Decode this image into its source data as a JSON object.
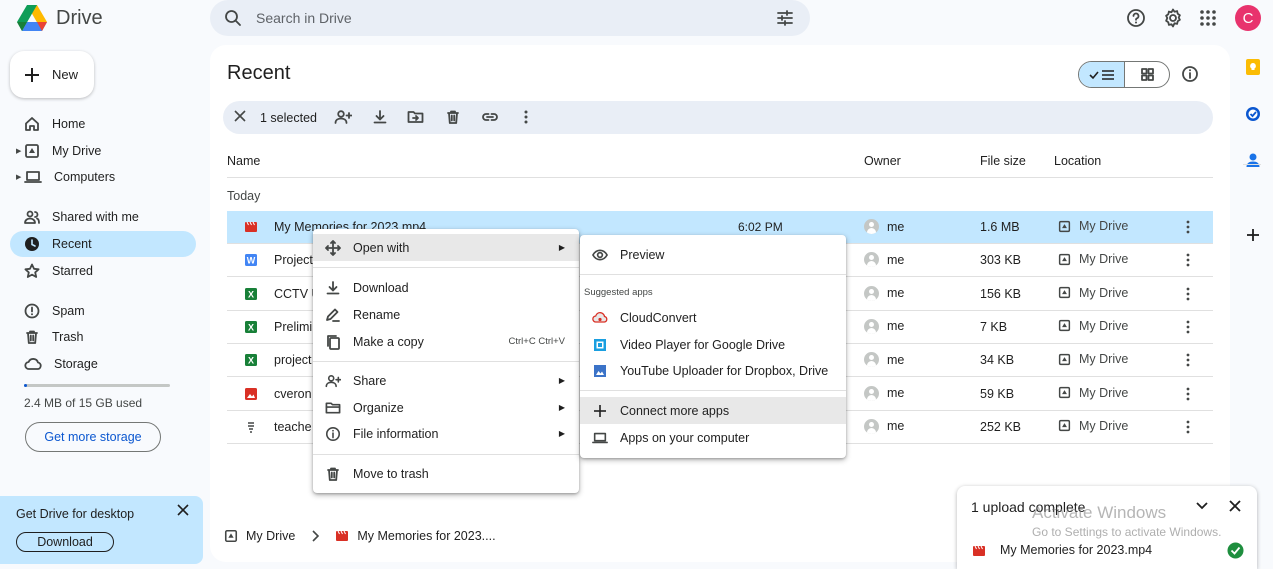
{
  "header": {
    "app_name": "Drive",
    "search_placeholder": "Search in Drive",
    "avatar_letter": "C",
    "icons": [
      "drive-logo-icon",
      "search-icon",
      "search-options-icon",
      "help-icon",
      "settings-icon",
      "apps-grid-icon"
    ]
  },
  "sidebar": {
    "new_label": "New",
    "items": [
      {
        "label": "Home",
        "icon": "home-icon"
      },
      {
        "label": "My Drive",
        "icon": "my-drive-icon"
      },
      {
        "label": "Computers",
        "icon": "computer-icon"
      },
      {
        "label": "Shared with me",
        "icon": "shared-icon"
      },
      {
        "label": "Recent",
        "icon": "clock-icon"
      },
      {
        "label": "Starred",
        "icon": "star-icon"
      },
      {
        "label": "Spam",
        "icon": "spam-icon"
      },
      {
        "label": "Trash",
        "icon": "trash-icon"
      },
      {
        "label": "Storage",
        "icon": "cloud-icon"
      }
    ],
    "storage_used_fraction": 0.0002,
    "storage_text": "2.4 MB of 15 GB used",
    "get_storage_label": "Get more storage",
    "desktop_promo_title": "Get Drive for desktop",
    "desktop_promo_button": "Download"
  },
  "main": {
    "title": "Recent",
    "selection_text": "1 selected",
    "columns": {
      "name": "Name",
      "owner": "Owner",
      "size": "File size",
      "location": "Location"
    },
    "section": "Today",
    "files": [
      {
        "name": "My Memories for 2023.mp4",
        "type": "video",
        "time": "6:02 PM",
        "owner": "me",
        "size": "1.6 MB",
        "location": "My Drive",
        "selected": true
      },
      {
        "name": "Project",
        "type": "doc",
        "owner": "me",
        "size": "303 KB",
        "location": "My Drive"
      },
      {
        "name": "CCTV U",
        "type": "sheet",
        "owner": "me",
        "size": "156 KB",
        "location": "My Drive"
      },
      {
        "name": "Prelimi",
        "type": "sheet",
        "owner": "me",
        "size": "7 KB",
        "location": "My Drive"
      },
      {
        "name": "project",
        "type": "sheet",
        "owner": "me",
        "size": "34 KB",
        "location": "My Drive"
      },
      {
        "name": "cveron",
        "type": "image",
        "owner": "me",
        "size": "59 KB",
        "location": "My Drive"
      },
      {
        "name": "teache",
        "type": "text",
        "owner": "me",
        "size": "252 KB",
        "location": "My Drive"
      }
    ]
  },
  "breadcrumb": {
    "root": "My Drive",
    "file": "My Memories for 2023...."
  },
  "context_menu": {
    "items": [
      {
        "label": "Open with",
        "icon": "move-icon",
        "submenu": true
      },
      {
        "label": "Download",
        "icon": "download-icon"
      },
      {
        "label": "Rename",
        "icon": "rename-icon"
      },
      {
        "label": "Make a copy",
        "icon": "copy-icon",
        "shortcut": "Ctrl+C Ctrl+V"
      },
      {
        "label": "Share",
        "icon": "share-icon",
        "submenu": true
      },
      {
        "label": "Organize",
        "icon": "organize-icon",
        "submenu": true
      },
      {
        "label": "File information",
        "icon": "info-icon",
        "submenu": true
      },
      {
        "label": "Move to trash",
        "icon": "trash-icon"
      }
    ]
  },
  "open_with_menu": {
    "preview": "Preview",
    "suggested_header": "Suggested apps",
    "apps": [
      "CloudConvert",
      "Video Player for Google Drive",
      "YouTube Uploader for Dropbox, Drive"
    ],
    "connect_more": "Connect more apps",
    "computer_apps": "Apps on your computer"
  },
  "upload_panel": {
    "title": "1 upload complete",
    "file": "My Memories for 2023.mp4"
  },
  "watermark": {
    "line1": "Activate Windows",
    "line2": "Go to Settings to activate Windows."
  },
  "colors": {
    "accent": "#0b57d0",
    "selected_bg": "#c2e7ff",
    "success": "#1e8e3e"
  }
}
